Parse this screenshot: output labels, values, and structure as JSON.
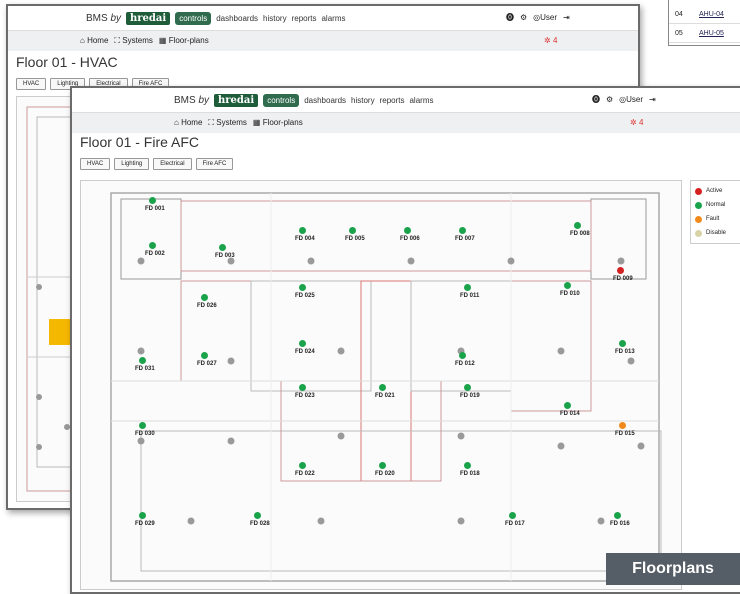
{
  "brand": {
    "prefix": "BMS",
    "by": "by",
    "name": "hredai"
  },
  "nav": {
    "items": [
      "controls",
      "dashboards",
      "history",
      "reports",
      "alarms"
    ],
    "active": "controls"
  },
  "user": {
    "label": "User"
  },
  "breadcrumb": {
    "home": "Home",
    "systems": "Systems",
    "floorplans": "Floor-plans"
  },
  "alarm_count": "4",
  "ahu_table": [
    {
      "n": "04",
      "name": "AHU-04"
    },
    {
      "n": "05",
      "name": "AHU-05"
    }
  ],
  "back_window": {
    "title": "Floor 01 - HVAC",
    "tabs": [
      "HVAC",
      "Lighting",
      "Electrical",
      "Fire AFC"
    ]
  },
  "front_window": {
    "title": "Floor 01 - Fire AFC",
    "tabs": [
      "HVAC",
      "Lighting",
      "Electrical",
      "Fire AFC"
    ]
  },
  "legend": [
    {
      "label": "Active",
      "color": "#d42020"
    },
    {
      "label": "Normal",
      "color": "#1aa34a"
    },
    {
      "label": "Fault",
      "color": "#f08a1c"
    },
    {
      "label": "Disable",
      "color": "#d8d3a6"
    }
  ],
  "detectors": [
    {
      "id": "FD 001",
      "status": "Normal"
    },
    {
      "id": "FD 002",
      "status": "Normal"
    },
    {
      "id": "FD 003",
      "status": "Normal"
    },
    {
      "id": "FD 004",
      "status": "Normal"
    },
    {
      "id": "FD 005",
      "status": "Normal"
    },
    {
      "id": "FD 006",
      "status": "Normal"
    },
    {
      "id": "FD 007",
      "status": "Normal"
    },
    {
      "id": "FD 008",
      "status": "Normal"
    },
    {
      "id": "FD 009",
      "status": "Active"
    },
    {
      "id": "FD 010",
      "status": "Normal"
    },
    {
      "id": "FD 011",
      "status": "Normal"
    },
    {
      "id": "FD 025",
      "status": "Normal"
    },
    {
      "id": "FD 026",
      "status": "Normal"
    },
    {
      "id": "FD 024",
      "status": "Normal"
    },
    {
      "id": "FD 027",
      "status": "Normal"
    },
    {
      "id": "FD 031",
      "status": "Normal"
    },
    {
      "id": "FD 012",
      "status": "Normal"
    },
    {
      "id": "FD 013",
      "status": "Normal"
    },
    {
      "id": "FD 023",
      "status": "Normal"
    },
    {
      "id": "FD 021",
      "status": "Normal"
    },
    {
      "id": "FD 019",
      "status": "Normal"
    },
    {
      "id": "FD 014",
      "status": "Normal"
    },
    {
      "id": "FD 015",
      "status": "Fault"
    },
    {
      "id": "FD 030",
      "status": "Normal"
    },
    {
      "id": "FD 022",
      "status": "Normal"
    },
    {
      "id": "FD 020",
      "status": "Normal"
    },
    {
      "id": "FD 018",
      "status": "Normal"
    },
    {
      "id": "FD 029",
      "status": "Normal"
    },
    {
      "id": "FD 028",
      "status": "Normal"
    },
    {
      "id": "FD 017",
      "status": "Normal"
    },
    {
      "id": "FD 016",
      "status": "Normal"
    }
  ],
  "caption": "Floorplans"
}
